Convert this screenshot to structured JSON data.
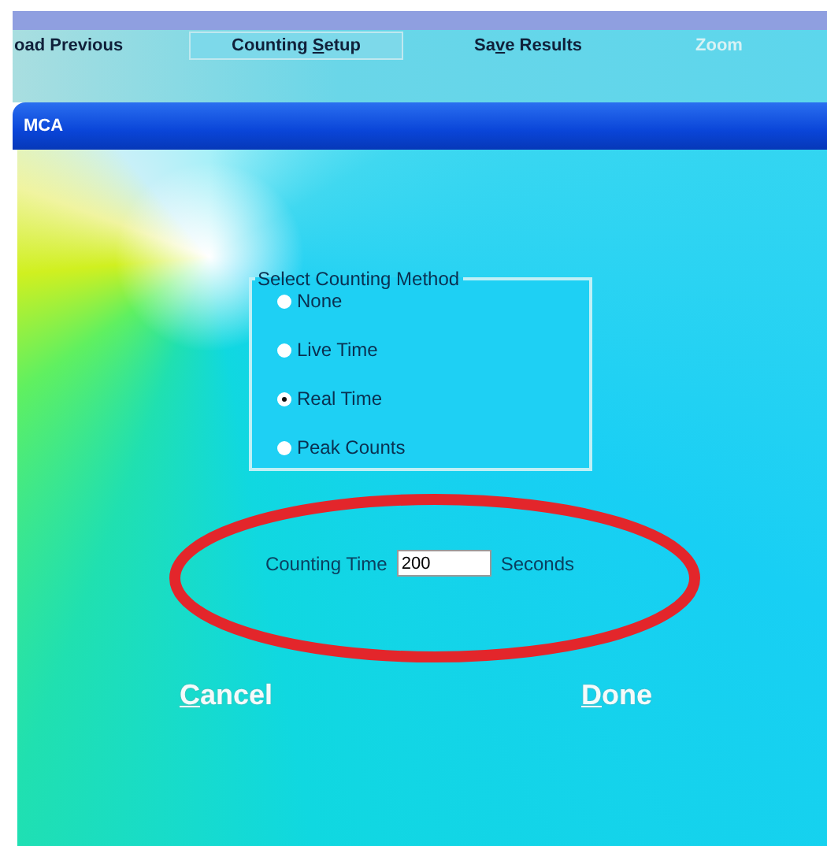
{
  "menu": [
    {
      "parts": {
        "before": "oad Previous"
      },
      "selected": false,
      "disabled": false
    },
    {
      "parts": {
        "before": "Counting ",
        "key": "S",
        "after": "etup"
      },
      "selected": true,
      "disabled": false
    },
    {
      "parts": {
        "before": "Sa",
        "key": "v",
        "after": "e Results"
      },
      "selected": false,
      "disabled": false
    },
    {
      "parts": {
        "before": "Zoom"
      },
      "selected": false,
      "disabled": true
    }
  ],
  "window": {
    "title": "MCA"
  },
  "counting_method": {
    "title": "Select Counting Method",
    "options": [
      {
        "label": "None",
        "selected": false
      },
      {
        "label": "Live Time",
        "selected": false
      },
      {
        "label": "Real Time",
        "selected": true
      },
      {
        "label": "Peak Counts",
        "selected": false
      }
    ]
  },
  "counting_time": {
    "label": "Counting Time",
    "value": "200",
    "unit": "Seconds"
  },
  "highlight": {
    "kind": "ellipse"
  },
  "buttons": [
    {
      "parts": {
        "key": "C",
        "after": "ancel"
      }
    },
    {
      "parts": {
        "key": "D",
        "after": "one"
      }
    }
  ]
}
